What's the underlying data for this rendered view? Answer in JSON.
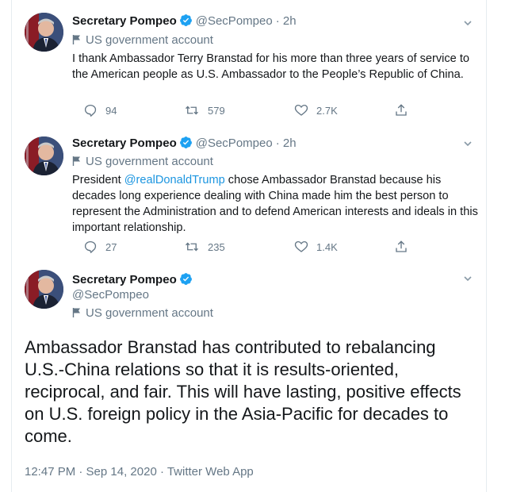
{
  "tweets": [
    {
      "name": "Secretary Pompeo",
      "handle": "@SecPompeo",
      "time": "· 2h",
      "badge": "US government account",
      "text": "I thank Ambassador Terry Branstad for his more than three years of service to the American people as U.S. Ambassador to the People’s Republic of China.",
      "replies": "94",
      "retweets": "579",
      "likes": "2.7K"
    },
    {
      "name": "Secretary Pompeo",
      "handle": "@SecPompeo",
      "time": "· 2h",
      "badge": "US government account",
      "text_prefix": "President ",
      "mention": "@realDonaldTrump",
      "text_suffix": " chose Ambassador Branstad because his decades long experience dealing with China made him the best person to represent the Administration and to defend American interests and ideals in this important relationship.",
      "replies": "27",
      "retweets": "235",
      "likes": "1.4K"
    }
  ],
  "main_tweet": {
    "name": "Secretary Pompeo",
    "handle": "@SecPompeo",
    "badge": "US government account",
    "text": "Ambassador Branstad has contributed to rebalancing U.S.-China relations so that it is results-oriented, reciprocal, and fair. This will have lasting, positive effects on U.S. foreign policy in the Asia-Pacific for decades to come.",
    "timestamp": "12:47 PM · Sep 14, 2020 · Twitter Web App"
  },
  "colors": {
    "link": "#1b95e0",
    "secondary_text": "#657786",
    "verified": "#1da1f2",
    "divider": "#e6ecf0"
  }
}
